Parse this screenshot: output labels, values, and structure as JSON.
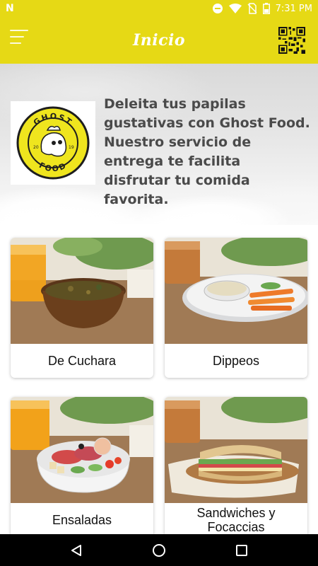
{
  "status_bar": {
    "left_glyph": "N",
    "time": "7:31 PM",
    "icons": [
      "minus-circle-icon",
      "wifi-icon",
      "no-sim-icon",
      "battery-icon"
    ]
  },
  "app_bar": {
    "title": "Inicio",
    "menu_icon": "hamburger-menu-icon",
    "qr_icon": "qr-code-icon"
  },
  "hero": {
    "text": "Deleita tus papilas gustativas con Ghost Food. Nuestro servicio de entrega te facilita disfrutar tu comida favorita.",
    "logo": {
      "top_text": "GHOST",
      "bottom_text": "FOOD",
      "year_left": "20",
      "year_right": "19"
    }
  },
  "categories": [
    {
      "label": "De Cuchara"
    },
    {
      "label": "Dippeos"
    },
    {
      "label": "Ensaladas"
    },
    {
      "label": "Sandwiches y Focaccias"
    }
  ],
  "nav_bar": {
    "back_icon": "back-triangle-icon",
    "home_icon": "home-circle-icon",
    "recents_icon": "recents-square-icon"
  },
  "colors": {
    "brand_yellow": "#e6d915",
    "text_gray": "#4a4a4a"
  }
}
